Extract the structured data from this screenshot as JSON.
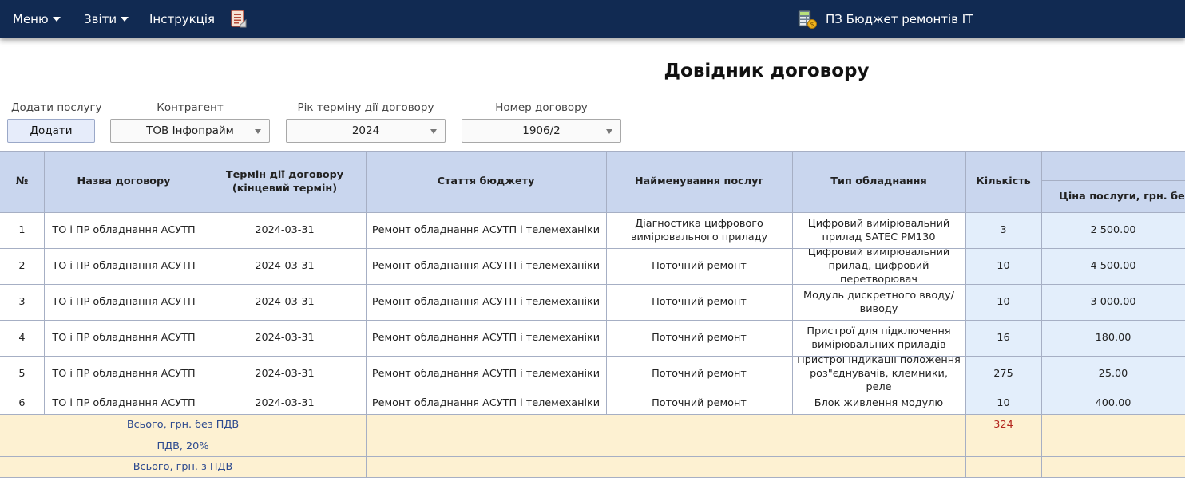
{
  "nav": {
    "menu_label": "Меню",
    "reports_label": "Звіти",
    "instruction_label": "Інструкція",
    "app_title": "ПЗ Бюджет ремонтів ІТ"
  },
  "page": {
    "title": "Довідник договору"
  },
  "controls": {
    "add_service_label": "Додати послугу",
    "add_button": "Додати",
    "counterparty_label": "Контрагент",
    "counterparty_value": "ТОВ Інфопрайм",
    "year_label": "Рік терміну дії договору",
    "year_value": "2024",
    "contract_no_label": "Номер договору",
    "contract_no_value": "1906/2"
  },
  "table": {
    "headers": {
      "no": "№",
      "contract_name": "Назва договору",
      "term": "Термін дії договору (кінцевий термін)",
      "budget_item": "Стаття бюджету",
      "service_name": "Найменування послуг",
      "equipment_type": "Тип обладнання",
      "quantity": "Кількість",
      "price": "Ціна послуги, грн. без ПД"
    },
    "rows": [
      [
        "1",
        "ТО і ПР обладнання АСУТП",
        "2024-03-31",
        "Ремонт обладнання АСУТП і телемеханіки",
        "Діагностика цифрового вимірювального приладу",
        "Цифровий вимірювальний прилад SATEC PM130",
        "3",
        "2 500.00"
      ],
      [
        "2",
        "ТО і ПР обладнання АСУТП",
        "2024-03-31",
        "Ремонт обладнання АСУТП і телемеханіки",
        "Поточний ремонт",
        "Цифровий вимірювальний прилад, цифровий перетворювач",
        "10",
        "4 500.00"
      ],
      [
        "3",
        "ТО і ПР обладнання АСУТП",
        "2024-03-31",
        "Ремонт обладнання АСУТП і телемеханіки",
        "Поточний ремонт",
        "Модуль дискретного вводу/виводу",
        "10",
        "3 000.00"
      ],
      [
        "4",
        "ТО і ПР обладнання АСУТП",
        "2024-03-31",
        "Ремонт обладнання АСУТП і телемеханіки",
        "Поточний ремонт",
        "Пристрої для підключення вимірювальних приладів",
        "16",
        "180.00"
      ],
      [
        "5",
        "ТО і ПР обладнання АСУТП",
        "2024-03-31",
        "Ремонт обладнання АСУТП і телемеханіки",
        "Поточний ремонт",
        "Пристрої індикації положення роз\"єднувачів, клемники, реле",
        "275",
        "25.00"
      ],
      [
        "6",
        "ТО і ПР обладнання АСУТП",
        "2024-03-31",
        "Ремонт обладнання АСУТП і телемеханіки",
        "Поточний ремонт",
        "Блок живлення модулю",
        "10",
        "400.00"
      ]
    ],
    "totals": [
      {
        "label": "Всього, грн. без ПДВ",
        "quantity": "324"
      },
      {
        "label": "ПДВ, 20%",
        "quantity": ""
      },
      {
        "label": "Всього, грн. з ПДВ",
        "quantity": ""
      }
    ]
  },
  "colors": {
    "topbar": "#112a52",
    "header_bg": "#c9d6ee",
    "quantity_bg": "#e3eefb",
    "totals_bg": "#fdf1d2",
    "totals_label": "#2d4a8f",
    "totals_value": "#b3261e"
  },
  "icons": {
    "menu_caret": "chevron-down-icon",
    "document": "document-icon",
    "app": "calculator-money-icon",
    "select_arrow": "chevron-down-icon"
  }
}
